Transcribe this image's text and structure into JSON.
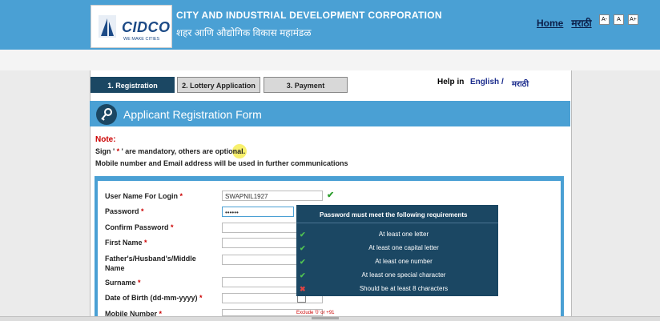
{
  "header": {
    "logo_brand": "CIDCO",
    "logo_tagline": "WE MAKE CITIES",
    "org_name_en": "CITY AND INDUSTRIAL DEVELOPMENT CORPORATION",
    "org_name_mr": "शहर आणि औद्योगिक विकास महामंडळ",
    "home_link": "Home",
    "marathi_link": "मराठी",
    "font_small": "A-",
    "font_normal": "A",
    "font_large": "A+"
  },
  "steps": [
    {
      "label": "1. Registration",
      "active": true
    },
    {
      "label": "2. Lottery Application",
      "active": false
    },
    {
      "label": "3. Payment",
      "active": false
    }
  ],
  "help": {
    "label": "Help in",
    "english": "English",
    "separator": "/",
    "marathi": "मराठी"
  },
  "form": {
    "title": "Applicant Registration Form",
    "note_label": "Note:",
    "note_line1_pre": "Sign '",
    "note_line1_star": " * ",
    "note_line1_post": "' are mandatory, others are optional.",
    "note_line2": "Mobile number and Email address will be used in further communications"
  },
  "fields": [
    {
      "label": "User Name For Login",
      "value": "SWAPNIL1927"
    },
    {
      "label": "Password",
      "value": "••••••"
    },
    {
      "label": "Confirm Password",
      "value": ""
    },
    {
      "label": "First Name",
      "value": ""
    },
    {
      "label": "Father's/Husband's/Middle",
      "label2": "Name",
      "value": ""
    },
    {
      "label": "Surname",
      "value": ""
    },
    {
      "label": "Date of Birth (dd-mm-yyyy)",
      "value": ""
    },
    {
      "label": "Mobile Number",
      "value": ""
    }
  ],
  "required_mark": "*",
  "tooltip": {
    "title": "Password must meet the following requirements",
    "items": [
      {
        "text": "At least one letter",
        "ok": true
      },
      {
        "text": "At least one capital letter",
        "ok": true
      },
      {
        "text": "At least one number",
        "ok": true
      },
      {
        "text": "At least one special character",
        "ok": true
      },
      {
        "text": "Should be at least 8 characters",
        "ok": false
      }
    ]
  },
  "mobile_hint": "Exclude '0' or +91",
  "colors": {
    "topbar": "#4aa0d4",
    "accent_dark": "#1b4763",
    "required": "#c00",
    "valid": "#2e9e2e",
    "invalid": "#e04343"
  }
}
